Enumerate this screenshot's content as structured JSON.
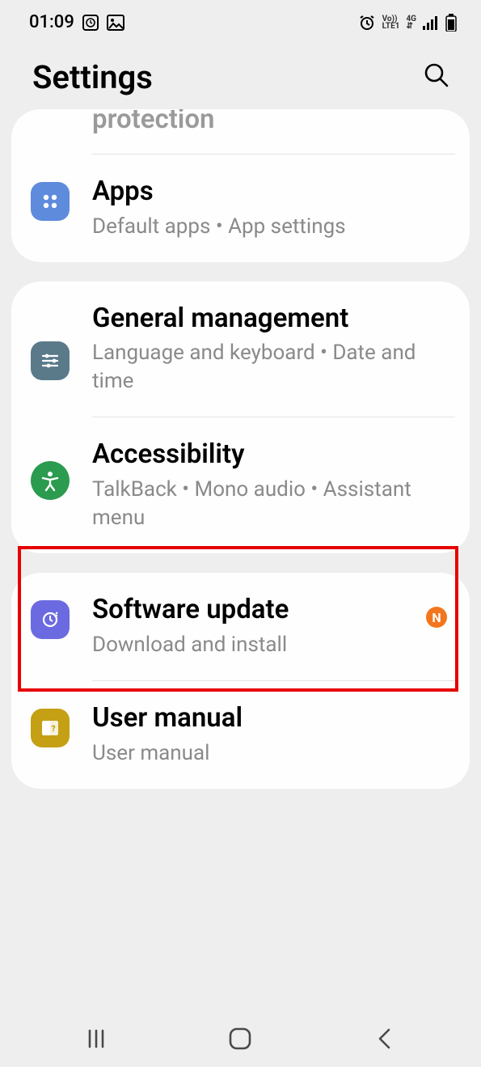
{
  "status_bar": {
    "time": "01:09"
  },
  "header": {
    "title": "Settings"
  },
  "cards": {
    "c0": {
      "partial": "protection",
      "apps": {
        "title": "Apps",
        "sub": "Default apps  •  App settings"
      }
    },
    "c1": {
      "general": {
        "title": "General management",
        "sub": "Language and keyboard  •  Date and time"
      },
      "accessibility": {
        "title": "Accessibility",
        "sub": "TalkBack  •  Mono audio  •  Assistant menu"
      }
    },
    "c2": {
      "software": {
        "title": "Software update",
        "sub": "Download and install",
        "badge": "N"
      },
      "user_manual": {
        "title": "User manual",
        "sub": "User manual"
      }
    }
  },
  "colors": {
    "apps_icon": "#5e8bdc",
    "general_icon": "#5a7a8a",
    "accessibility_icon": "#2b9b4f",
    "software_icon": "#6b6ae0",
    "user_manual_icon": "#c5a015",
    "badge": "#f2761e"
  }
}
